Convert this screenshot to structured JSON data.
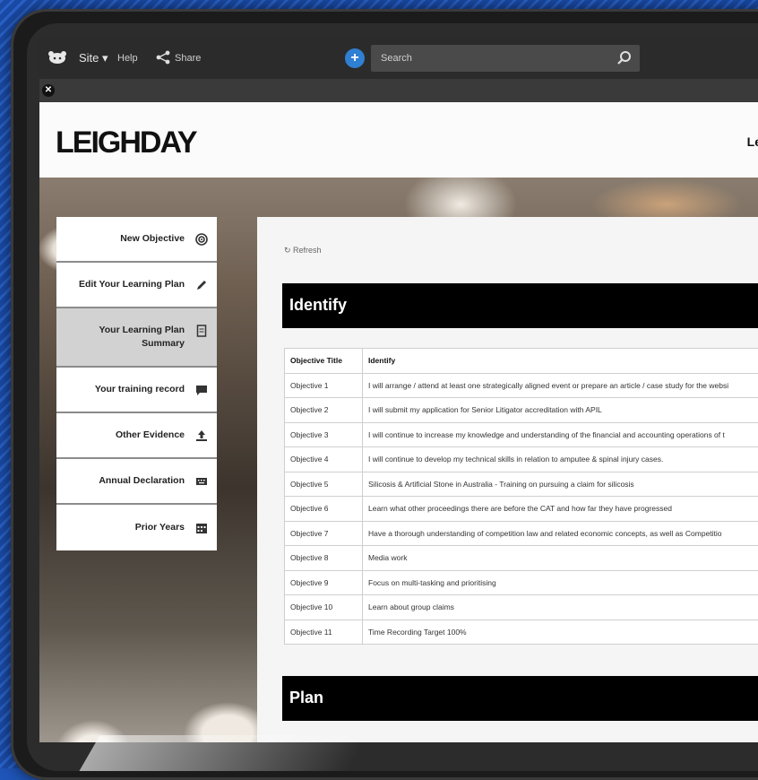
{
  "topbar": {
    "site_label": "Site ▾",
    "help_label": "Help",
    "share_label": "Share",
    "search_placeholder": "Search"
  },
  "header": {
    "brand": "LEIGHDAY",
    "right_text": "Le"
  },
  "sidebar": {
    "items": [
      {
        "label": "New Objective",
        "icon": "target-icon"
      },
      {
        "label": "Edit Your Learning Plan",
        "icon": "pencil-icon"
      },
      {
        "label": "Your Learning Plan Summary",
        "icon": "document-icon"
      },
      {
        "label": "Your training record",
        "icon": "chat-icon"
      },
      {
        "label": "Other Evidence",
        "icon": "upload-icon"
      },
      {
        "label": "Annual Declaration",
        "icon": "keyboard-icon"
      },
      {
        "label": "Prior Years",
        "icon": "calendar-icon"
      }
    ]
  },
  "content": {
    "refresh_label": "Refresh",
    "identify_heading": "Identify",
    "plan_heading": "Plan",
    "table": {
      "headers": [
        "Objective Title",
        "Identify"
      ],
      "rows": [
        [
          "Objective 1",
          "I will arrange / attend at least one strategically aligned event or prepare an article / case study for the websi"
        ],
        [
          "Objective 2",
          "I will submit my application for Senior Litigator accreditation with APIL"
        ],
        [
          "Objective 3",
          "I will continue to increase my knowledge and understanding of the financial and accounting operations of t"
        ],
        [
          "Objective 4",
          "I will continue to develop my technical skills in relation to amputee & spinal injury cases."
        ],
        [
          "Objective 5",
          "Silicosis & Artificial Stone in Australia - Training on pursuing a claim for silicosis"
        ],
        [
          "Objective 6",
          "Learn what other proceedings there are before the CAT and how far they have progressed"
        ],
        [
          "Objective 7",
          "Have a thorough understanding of competition law and related economic concepts, as well as Competitio"
        ],
        [
          "Objective 8",
          "Media work"
        ],
        [
          "Objective 9",
          "Focus on multi-tasking and prioritising"
        ],
        [
          "Objective 10",
          "Learn about group claims"
        ],
        [
          "Objective 11",
          "Time Recording Target 100%"
        ]
      ]
    }
  }
}
